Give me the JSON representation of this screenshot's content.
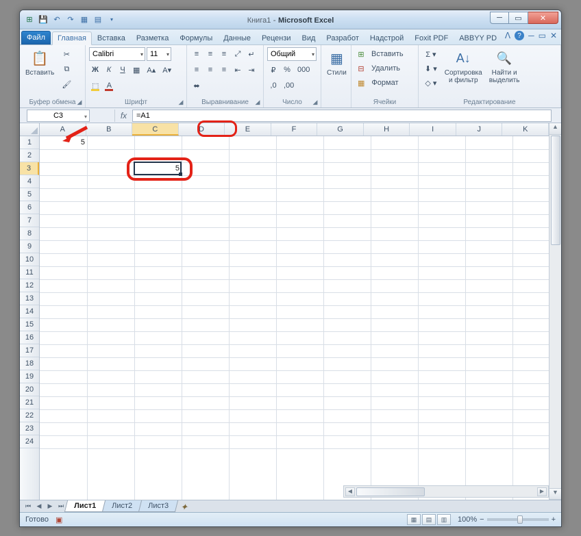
{
  "title": {
    "doc": "Книга1",
    "app": "Microsoft Excel"
  },
  "qat": {
    "save_icon": "save-icon",
    "undo_icon": "undo-icon",
    "redo_icon": "redo-icon"
  },
  "tabs": {
    "file": "Файл",
    "list": [
      "Главная",
      "Вставка",
      "Разметка",
      "Формулы",
      "Данные",
      "Рецензи",
      "Вид",
      "Разработ",
      "Надстрой",
      "Foxit PDF",
      "ABBYY PD"
    ],
    "active": 0
  },
  "ribbon": {
    "clipboard": {
      "label": "Буфер обмена",
      "paste": "Вставить"
    },
    "font": {
      "label": "Шрифт",
      "family": "Calibri",
      "size": "11",
      "bold": "Ж",
      "italic": "К",
      "underline": "Ч"
    },
    "align": {
      "label": "Выравнивание"
    },
    "number": {
      "label": "Число",
      "format": "Общий"
    },
    "styles": {
      "label": "",
      "styles": "Стили"
    },
    "cells": {
      "label": "Ячейки",
      "insert": "Вставить",
      "delete": "Удалить",
      "format": "Формат"
    },
    "editing": {
      "label": "Редактирование",
      "sort": "Сортировка\nи фильтр",
      "find": "Найти и\nвыделить"
    }
  },
  "formula": {
    "namebox": "C3",
    "value": "=A1"
  },
  "grid": {
    "cols": [
      "A",
      "B",
      "C",
      "D",
      "E",
      "F",
      "G",
      "H",
      "I",
      "J",
      "K"
    ],
    "rows": 24,
    "selected": {
      "row": 3,
      "col": "C"
    },
    "a1": "5",
    "c3": "5"
  },
  "sheets": {
    "list": [
      "Лист1",
      "Лист2",
      "Лист3"
    ],
    "active": 0
  },
  "status": {
    "ready": "Готово",
    "zoom": "100%"
  }
}
